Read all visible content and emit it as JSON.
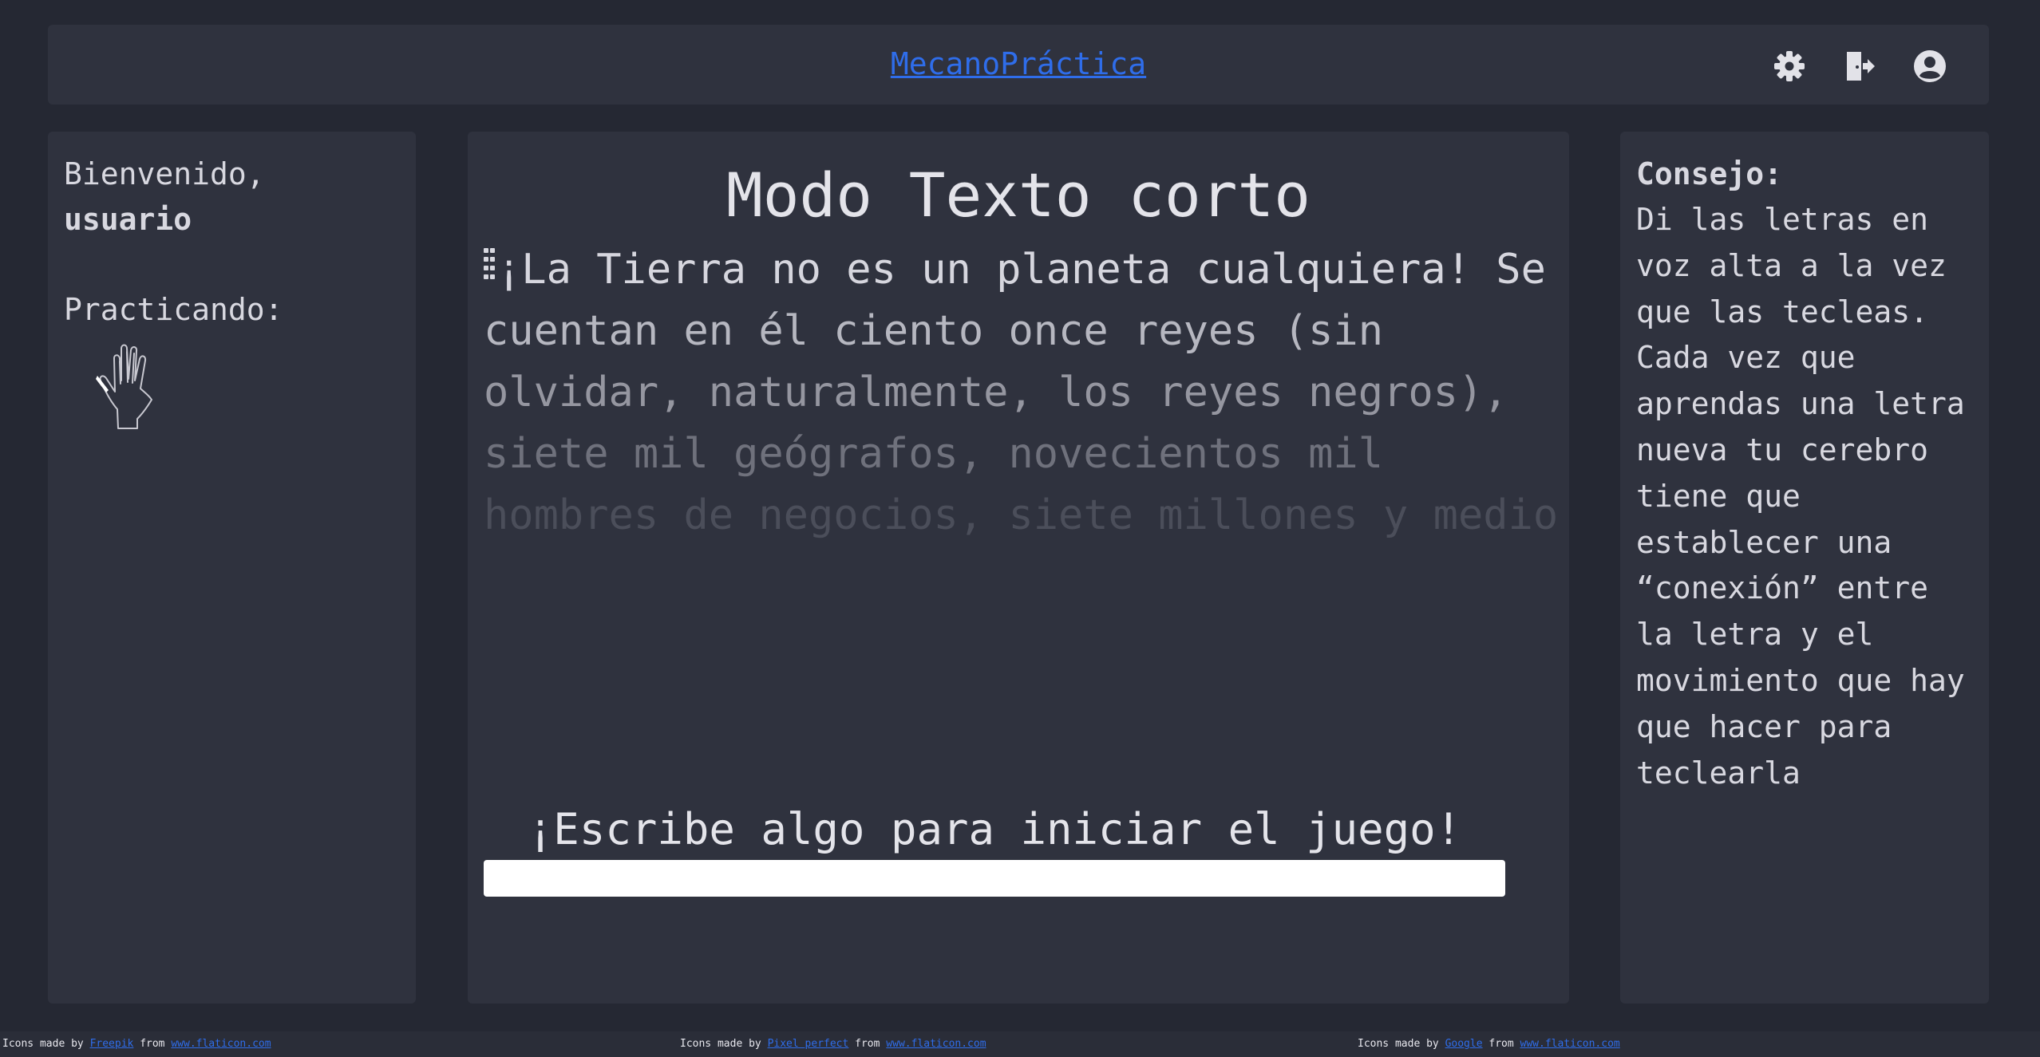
{
  "header": {
    "app_title": "MecanoPráctica",
    "icons": [
      "gear-icon",
      "exit-icon",
      "user-circle-icon"
    ]
  },
  "left_panel": {
    "welcome_text": "Bienvenido,",
    "username": "usuario",
    "practicing_label": "Practicando:"
  },
  "center_panel": {
    "mode_title": "Modo Texto corto",
    "text_lines": [
      "¡La Tierra no es un planeta cualquiera! Se",
      "cuentan en él ciento once reyes (sin",
      "olvidar, naturalmente, los reyes negros),",
      "siete mil geógrafos, novecientos mil",
      "hombres de negocios, siete millones y medio"
    ],
    "start_prompt": "¡Escribe algo para iniciar el juego!",
    "input_value": ""
  },
  "right_panel": {
    "tip_title": "Consejo:",
    "tip_lines": [
      "Di las letras en",
      "voz alta a la vez",
      "que las tecleas.",
      "Cada vez que",
      "aprendas una letra",
      "nueva tu cerebro",
      "tiene que",
      "establecer una",
      "“conexión” entre",
      "la letra y el",
      "movimiento que hay",
      "que hacer para",
      "teclearla"
    ]
  },
  "footer": {
    "credits": [
      {
        "prefix": "Icons made by",
        "author": "Freepik",
        "mid": "from",
        "site": "www.flaticon.com"
      },
      {
        "prefix": "Icons made by",
        "author": "Pixel perfect",
        "mid": "from",
        "site": "www.flaticon.com"
      },
      {
        "prefix": "Icons made by",
        "author": "Google",
        "mid": "from",
        "site": "www.flaticon.com"
      }
    ]
  },
  "colors": {
    "background": "#252833",
    "panel": "#2f323e",
    "accent_link": "#2f6dea",
    "text": "#d8d8e0"
  }
}
